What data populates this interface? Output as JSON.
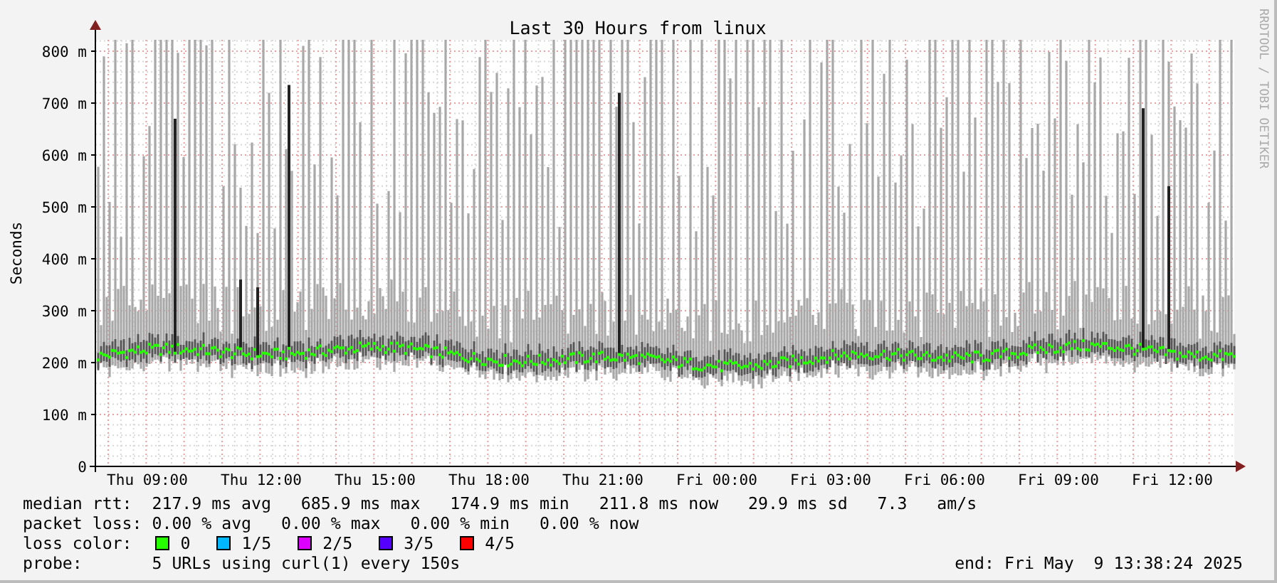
{
  "graph": {
    "title": "Last 30 Hours from linux",
    "y_axis_label": "Seconds",
    "credit": "RRDTOOL / TOBI OETIKER",
    "y_ticks": [
      "800 m",
      "700 m",
      "600 m",
      "500 m",
      "400 m",
      "300 m",
      "200 m",
      "100 m",
      "0"
    ],
    "x_ticks": [
      "Thu 09:00",
      "Thu 12:00",
      "Thu 15:00",
      "Thu 18:00",
      "Thu 21:00",
      "Fri 00:00",
      "Fri 03:00",
      "Fri 06:00",
      "Fri 09:00",
      "Fri 12:00"
    ]
  },
  "legend": {
    "median_rtt": {
      "label": "median rtt:",
      "value": "217.9 ms avg   685.9 ms max   174.9 ms min   211.8 ms now   29.9 ms sd   7.3   am/s"
    },
    "packet_loss": {
      "label": "packet loss:",
      "value": "0.00 % avg   0.00 % max   0.00 % min   0.00 % now"
    },
    "loss_color": {
      "label": "loss color:",
      "items": [
        {
          "label": "0",
          "color": "#26ff00"
        },
        {
          "label": "1/5",
          "color": "#00b8ff"
        },
        {
          "label": "2/5",
          "color": "#dd00ff"
        },
        {
          "label": "3/5",
          "color": "#5500ff"
        },
        {
          "label": "4/5",
          "color": "#ff0000"
        }
      ]
    },
    "probe": {
      "label": "probe:",
      "value": "5 URLs using curl(1) every 150s"
    },
    "end": "end: Fri May  9 13:38:24 2025"
  }
}
